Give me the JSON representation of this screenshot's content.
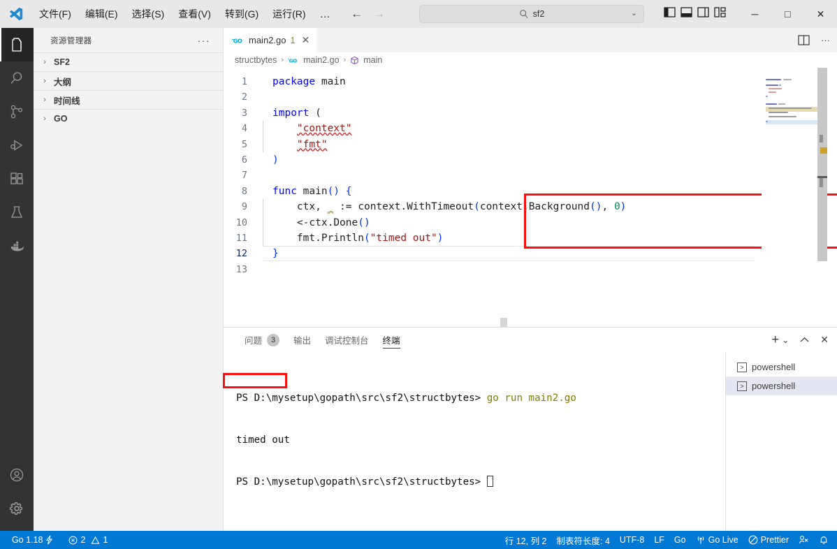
{
  "titlebar": {
    "logo": "vscode-logo",
    "menus": [
      {
        "label": "文件(F)",
        "name": "menu-file"
      },
      {
        "label": "编辑(E)",
        "name": "menu-edit"
      },
      {
        "label": "选择(S)",
        "name": "menu-selection"
      },
      {
        "label": "查看(V)",
        "name": "menu-view"
      },
      {
        "label": "转到(G)",
        "name": "menu-go"
      },
      {
        "label": "运行(R)",
        "name": "menu-run"
      }
    ],
    "more": "…",
    "back_arrow": "←",
    "forward_arrow": "→",
    "search": {
      "value": "sf2",
      "icon": "search-icon",
      "chevron": "⌄"
    },
    "layout_icons": [
      "toggle-primary-sidebar-icon",
      "toggle-panel-icon",
      "toggle-secondary-sidebar-icon",
      "customize-layout-icon"
    ],
    "window_controls": {
      "minimize": "─",
      "maximize": "□",
      "close": "✕"
    }
  },
  "activitybar": {
    "items": [
      {
        "name": "explorer",
        "icon": "files-icon",
        "active": true
      },
      {
        "name": "search",
        "icon": "search-icon",
        "active": false
      },
      {
        "name": "source-control",
        "icon": "source-control-icon",
        "active": false
      },
      {
        "name": "run-and-debug",
        "icon": "run-debug-icon",
        "active": false
      },
      {
        "name": "extensions",
        "icon": "extensions-icon",
        "active": false
      },
      {
        "name": "testing",
        "icon": "beaker-icon",
        "active": false
      },
      {
        "name": "docker",
        "icon": "docker-icon",
        "active": false
      }
    ],
    "bottom": [
      {
        "name": "accounts",
        "icon": "account-icon"
      },
      {
        "name": "manage",
        "icon": "gear-icon"
      }
    ]
  },
  "sidebar": {
    "title": "资源管理器",
    "more": "···",
    "sections": [
      {
        "label": "SF2",
        "chevron": "›"
      },
      {
        "label": "大纲",
        "chevron": "›"
      },
      {
        "label": "时间线",
        "chevron": "›"
      },
      {
        "label": "GO",
        "chevron": "›"
      }
    ]
  },
  "editor": {
    "tab": {
      "icon": "go-file-icon",
      "icon_text": "GO",
      "title": "main2.go",
      "badge": "1",
      "close": "✕"
    },
    "tab_actions": {
      "split": "split-editor-icon",
      "more": "···"
    },
    "breadcrumb": [
      {
        "label": "structbytes",
        "icon": null
      },
      {
        "label": "main2.go",
        "icon": "go-file-icon"
      },
      {
        "label": "main",
        "icon": "symbol-namespace-icon"
      }
    ],
    "breadcrumb_sep": "›",
    "status": {
      "line_col": "行 12, 列 2",
      "cursor_line": 12
    },
    "code": {
      "lines": [
        {
          "n": "1",
          "tokens": [
            {
              "t": "package",
              "c": "kw"
            },
            {
              "t": " ",
              "c": "pl"
            },
            {
              "t": "main",
              "c": "pkg"
            }
          ],
          "indent": 0
        },
        {
          "n": "2",
          "tokens": [],
          "indent": 0
        },
        {
          "n": "3",
          "tokens": [
            {
              "t": "import",
              "c": "kw"
            },
            {
              "t": " (",
              "c": "pl"
            }
          ],
          "indent": 0
        },
        {
          "n": "4",
          "tokens": [
            {
              "t": "    ",
              "c": "pl"
            },
            {
              "t": "\"context\"",
              "c": "str-err"
            }
          ],
          "indent": 1
        },
        {
          "n": "5",
          "tokens": [
            {
              "t": "    ",
              "c": "pl"
            },
            {
              "t": "\"fmt\"",
              "c": "str-err"
            }
          ],
          "indent": 1
        },
        {
          "n": "6",
          "tokens": [
            {
              "t": ")",
              "c": "paren"
            }
          ],
          "indent": 0
        },
        {
          "n": "7",
          "tokens": [],
          "indent": 0
        },
        {
          "n": "8",
          "tokens": [
            {
              "t": "func",
              "c": "kw"
            },
            {
              "t": " ",
              "c": "pl"
            },
            {
              "t": "main",
              "c": "fn"
            },
            {
              "t": "()",
              "c": "paren"
            },
            {
              "t": " ",
              "c": "pl"
            },
            {
              "t": "{",
              "c": "paren"
            }
          ],
          "indent": 0
        },
        {
          "n": "9",
          "tokens": [
            {
              "t": "    ",
              "c": "pl"
            },
            {
              "t": "ctx, ",
              "c": "var"
            },
            {
              "t": "_",
              "c": "unused"
            },
            {
              "t": " := ",
              "c": "pl"
            },
            {
              "t": "context",
              "c": "var"
            },
            {
              "t": ".",
              "c": "pl"
            },
            {
              "t": "WithTimeout",
              "c": "var"
            },
            {
              "t": "(",
              "c": "paren"
            },
            {
              "t": "context",
              "c": "var"
            },
            {
              "t": ".",
              "c": "pl"
            },
            {
              "t": "Background",
              "c": "var"
            },
            {
              "t": "()",
              "c": "paren"
            },
            {
              "t": ", ",
              "c": "pl"
            },
            {
              "t": "0",
              "c": "num"
            },
            {
              "t": ")",
              "c": "paren"
            }
          ],
          "indent": 1
        },
        {
          "n": "10",
          "tokens": [
            {
              "t": "    ",
              "c": "pl"
            },
            {
              "t": "<-ctx",
              "c": "var"
            },
            {
              "t": ".",
              "c": "pl"
            },
            {
              "t": "Done",
              "c": "var"
            },
            {
              "t": "()",
              "c": "paren"
            }
          ],
          "indent": 1
        },
        {
          "n": "11",
          "tokens": [
            {
              "t": "    ",
              "c": "pl"
            },
            {
              "t": "fmt",
              "c": "var"
            },
            {
              "t": ".",
              "c": "pl"
            },
            {
              "t": "Println",
              "c": "var"
            },
            {
              "t": "(",
              "c": "paren"
            },
            {
              "t": "\"timed out\"",
              "c": "str"
            },
            {
              "t": ")",
              "c": "paren"
            }
          ],
          "indent": 1
        },
        {
          "n": "12",
          "tokens": [
            {
              "t": "}",
              "c": "paren"
            }
          ],
          "indent": 0,
          "active": true
        },
        {
          "n": "13",
          "tokens": [],
          "indent": 0
        }
      ]
    },
    "annotation": {
      "color": "#fa0f0f",
      "label": "code-highlight-box"
    }
  },
  "panel": {
    "tabs": [
      {
        "label": "问题",
        "badge": "3",
        "active": false,
        "name": "tab-problems"
      },
      {
        "label": "输出",
        "badge": null,
        "active": false,
        "name": "tab-output"
      },
      {
        "label": "调试控制台",
        "badge": null,
        "active": false,
        "name": "tab-debug-console"
      },
      {
        "label": "终端",
        "badge": null,
        "active": true,
        "name": "tab-terminal"
      }
    ],
    "actions": {
      "new": "+",
      "dropdown": "⌄",
      "maximize": "⌃",
      "close": "✕"
    },
    "terminal": {
      "lines": [
        {
          "prompt": "PS D:\\mysetup\\gopath\\src\\sf2\\structbytes> ",
          "command": "go run main2.go",
          "type": "prompt"
        },
        {
          "text": "timed out",
          "type": "output",
          "annotated": true
        },
        {
          "prompt": "PS D:\\mysetup\\gopath\\src\\sf2\\structbytes> ",
          "command": "",
          "type": "prompt",
          "cursor": true
        }
      ],
      "instances": [
        {
          "label": "powershell",
          "icon": "terminal-icon",
          "selected": false
        },
        {
          "label": "powershell",
          "icon": "terminal-icon",
          "selected": true
        }
      ]
    }
  },
  "statusbar": {
    "bg": "#0078d4",
    "left": [
      {
        "label": "Go 1.18",
        "icon": "lightning-icon",
        "name": "status-go-version"
      },
      {
        "label": "2",
        "icon": "error-icon",
        "name": "status-errors",
        "second_label": "1",
        "second_icon": "warning-icon"
      }
    ],
    "go_version": "Go 1.18",
    "errors": "2",
    "warnings": "1",
    "right": [
      {
        "label": "行 12, 列 2",
        "name": "status-line-col"
      },
      {
        "label": "制表符长度: 4",
        "name": "status-tab-size"
      },
      {
        "label": "UTF-8",
        "name": "status-encoding"
      },
      {
        "label": "LF",
        "name": "status-eol"
      },
      {
        "label": "Go",
        "name": "status-language"
      },
      {
        "label": "Go Live",
        "icon": "broadcast-icon",
        "name": "status-go-live"
      },
      {
        "label": "Prettier",
        "icon": "prettier-icon",
        "name": "status-prettier"
      }
    ],
    "right_icons": [
      {
        "icon": "remote-icon",
        "name": "status-remote"
      },
      {
        "icon": "bell-icon",
        "name": "status-notifications"
      }
    ]
  },
  "colors": {
    "accent": "#0078d4",
    "titlebar_bg": "#e8e8e8",
    "sidebar_bg": "#f3f3f3",
    "activitybar_bg": "#333333",
    "editor_bg": "#ffffff",
    "annotation_red": "#fa0f0f",
    "keyword_blue": "#0000ff",
    "string_red": "#a31515",
    "number_green": "#098658"
  }
}
